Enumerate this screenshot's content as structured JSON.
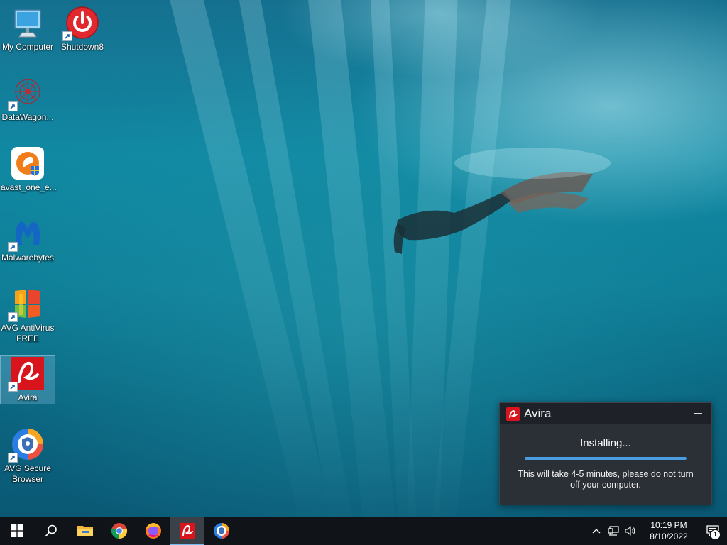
{
  "desktop": {
    "icons": [
      {
        "label": "My Computer"
      },
      {
        "label": "Shutdown8"
      },
      {
        "label": "DataWagon..."
      },
      {
        "label": "avast_one_e..."
      },
      {
        "label": "Malwarebytes"
      },
      {
        "label": "AVG AntiVirus FREE"
      },
      {
        "label": "Avira"
      },
      {
        "label": "AVG Secure Browser"
      }
    ]
  },
  "avira_popup": {
    "title": "Avira",
    "status": "Installing...",
    "message": "This will take 4-5 minutes, please do not turn off your computer.",
    "progress": 1.0,
    "accent_color": "#d8141d"
  },
  "taskbar": {
    "pinned": [
      {
        "name": "start"
      },
      {
        "name": "search"
      },
      {
        "name": "file-explorer"
      },
      {
        "name": "chrome"
      },
      {
        "name": "firefox"
      },
      {
        "name": "avira",
        "active": true
      },
      {
        "name": "avg-secure-browser"
      }
    ],
    "clock": {
      "time": "10:19 PM",
      "date": "8/10/2022"
    },
    "notification_count": "1"
  }
}
